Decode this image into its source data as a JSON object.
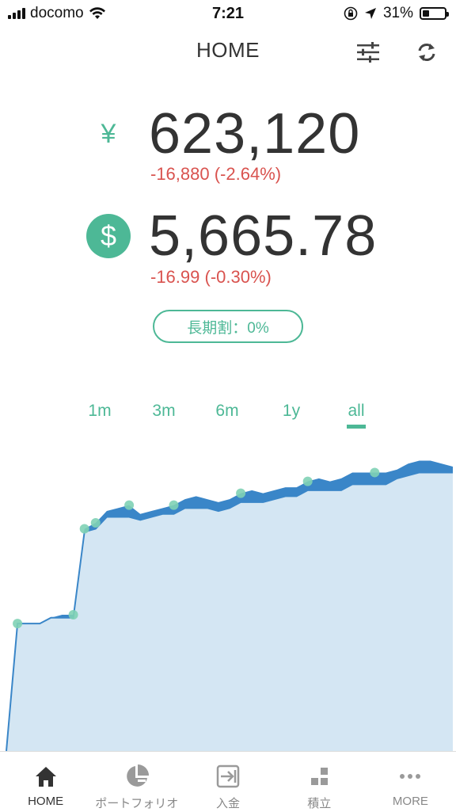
{
  "status_bar": {
    "carrier": "docomo",
    "time": "7:21",
    "battery_percent": "31%",
    "battery_level": 0.31
  },
  "header": {
    "title": "HOME",
    "filter_icon": "sliders-icon",
    "refresh_icon": "refresh-icon"
  },
  "balances": {
    "yen": {
      "symbol": "¥",
      "amount": "623,120",
      "change": "-16,880 (-2.64%)"
    },
    "usd": {
      "symbol": "$",
      "amount": "5,665.78",
      "change": "-16.99 (-0.30%)"
    }
  },
  "long_term_discount": {
    "label": "長期割：0%"
  },
  "range_tabs": [
    {
      "label": "1m"
    },
    {
      "label": "3m"
    },
    {
      "label": "6m"
    },
    {
      "label": "1y"
    },
    {
      "label": "all",
      "selected": true
    }
  ],
  "colors": {
    "accent": "#4db896",
    "negative": "#d9534f",
    "area_fill": "#d4e6f3",
    "line": "#3a86c8",
    "marker": "#7fd1b5"
  },
  "chart_data": {
    "type": "area",
    "title": "",
    "xlabel": "",
    "ylabel": "",
    "grid": false,
    "ylim": [
      0,
      100
    ],
    "x": [
      0,
      1,
      2,
      3,
      4,
      5,
      6,
      7,
      8,
      9,
      10,
      11,
      12,
      13,
      14,
      15,
      16,
      17,
      18,
      19,
      20,
      21,
      22,
      23,
      24,
      25,
      26,
      27,
      28,
      29,
      30,
      31,
      32,
      33,
      34,
      35,
      36,
      37,
      38,
      39,
      40
    ],
    "series": [
      {
        "values": [
          0,
          43,
          43,
          43,
          45,
          46,
          46,
          75,
          77,
          81,
          82,
          83,
          80,
          81,
          82,
          83,
          85,
          86,
          85,
          84,
          85,
          87,
          88,
          87,
          88,
          89,
          89,
          91,
          92,
          91,
          92,
          94,
          94,
          94,
          94,
          95,
          97,
          98,
          98,
          97,
          96
        ]
      },
      {
        "values": [
          0,
          43,
          43,
          43,
          45,
          45,
          45,
          74,
          75,
          79,
          79,
          79,
          78,
          79,
          80,
          80,
          82,
          82,
          82,
          81,
          82,
          84,
          84,
          84,
          85,
          86,
          86,
          88,
          88,
          88,
          88,
          90,
          90,
          90,
          90,
          92,
          93,
          94,
          94,
          94,
          94
        ]
      }
    ],
    "markers": [
      1,
      6,
      7,
      8,
      11,
      15,
      21,
      27,
      33
    ]
  },
  "bottom_nav": [
    {
      "label": "HOME",
      "icon": "home-icon",
      "active": true
    },
    {
      "label": "ポートフォリオ",
      "icon": "pie-chart-icon"
    },
    {
      "label": "入金",
      "icon": "deposit-icon"
    },
    {
      "label": "積立",
      "icon": "blocks-icon"
    },
    {
      "label": "MORE",
      "icon": "more-icon"
    }
  ]
}
